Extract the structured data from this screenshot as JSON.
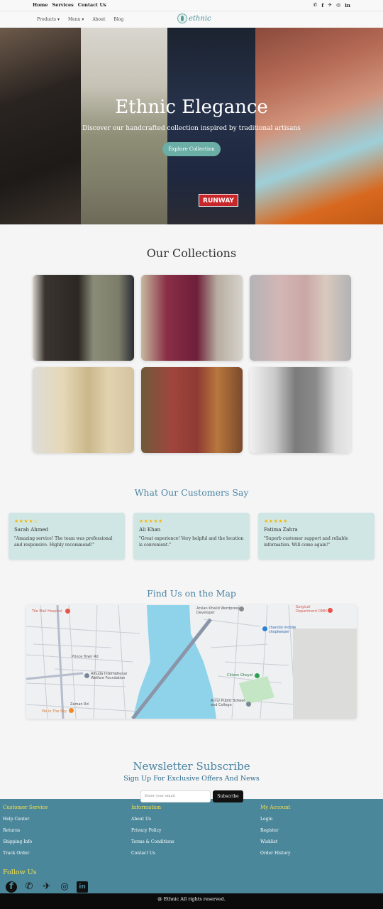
{
  "topbar": {
    "links": [
      "Home",
      "Services",
      "Contact Us"
    ],
    "social_icons": [
      "whatsapp-icon",
      "facebook-icon",
      "twitter-icon",
      "instagram-icon",
      "linkedin-icon"
    ]
  },
  "navbar": {
    "menu": [
      "Products ▾",
      "Menu ▾",
      "About",
      "Blog"
    ],
    "logo_text": "ethnic"
  },
  "hero": {
    "title": "Ethnic Elegance",
    "subtitle": "Discover our handcrafted collection inspired by traditional artisans",
    "button": "Explore Collection",
    "badge": "RUNWAY"
  },
  "collections": {
    "title": "Our Collections"
  },
  "testimonials": {
    "title": "What Our Customers Say",
    "items": [
      {
        "stars": "★★★★☆",
        "name": "Sarah Ahmed",
        "text": "\"Amazing service! The team was professional and responsive. Highly recommend!\""
      },
      {
        "stars": "★★★★★",
        "name": "Ali Khan",
        "text": "\"Great experience! Very helpful and the location is convenient.\""
      },
      {
        "stars": "★★★★★",
        "name": "Fatima Zahra",
        "text": "\"Superb customer support and reliable information. Will come again!\""
      }
    ]
  },
  "map": {
    "title": "Find Us on the Map",
    "labels": [
      "Tile Mall Hospital",
      "Arslan Khalid Wordpress Developer",
      "Surgical Department DMH",
      "chandio mobile shopkeeper",
      "Alhuda International Welfare Foundation",
      "Citizen Ghoyal",
      "Army Public School and College",
      "Pie in The Sky",
      "Prince Town Rd",
      "Zaman Rd"
    ]
  },
  "newsletter": {
    "title": "Newsletter Subscribe",
    "subtitle": "Sign Up For Exclusive Offers And News",
    "placeholder": "Enter your email",
    "button": "Subscribe"
  },
  "footer": {
    "columns": [
      {
        "heading": "Customer Service",
        "items": [
          "Help Center",
          "Returns",
          "Shipping Info",
          "Track Order"
        ]
      },
      {
        "heading": "Information",
        "items": [
          "About Us",
          "Privacy Policy",
          "Terms & Conditions",
          "Contact Us"
        ]
      },
      {
        "heading": "My Account",
        "items": [
          "Login",
          "Register",
          "Wishlist",
          "Order History"
        ]
      }
    ],
    "follow": "Follow Us",
    "copyright": "@ Ethnic All rights reserved."
  },
  "colors": {
    "accent": "#6aaea6",
    "heading_blue": "#4b84a3",
    "footer_bg": "#4b879a",
    "footer_heading": "#f4e04d",
    "card_bg": "#cfe6e4"
  }
}
